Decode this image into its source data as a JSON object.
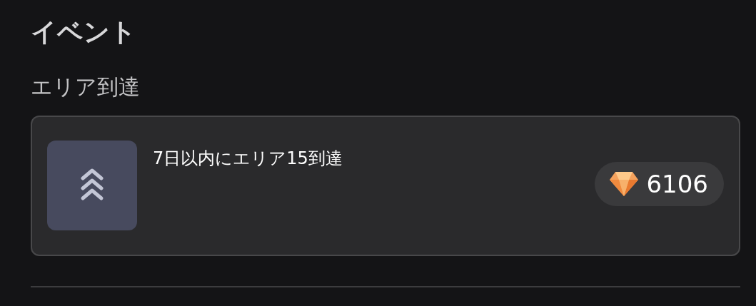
{
  "section_title": "イベント",
  "subsection_title": "エリア到達",
  "achievements": [
    {
      "label": "7日以内にエリア15到達",
      "reward": "6106"
    }
  ]
}
